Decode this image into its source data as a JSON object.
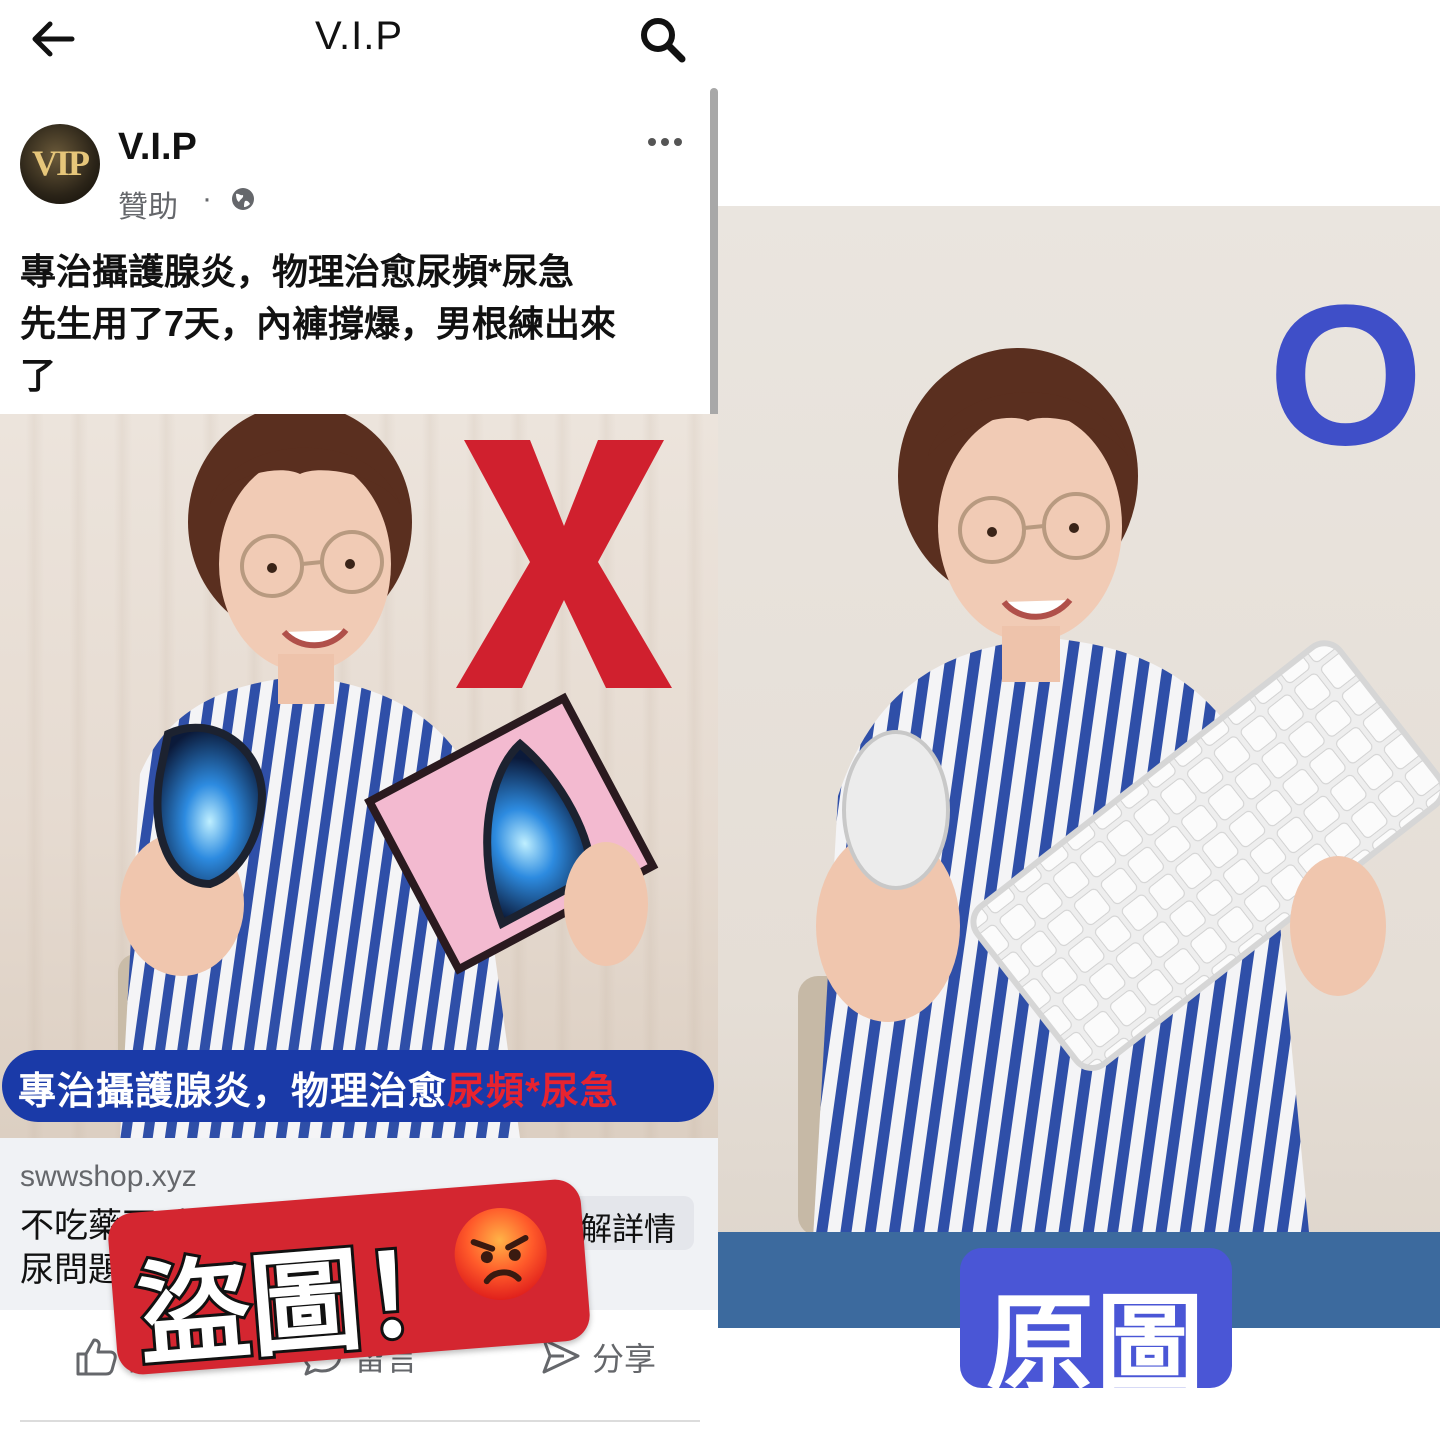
{
  "topbar": {
    "title": "V.I.P"
  },
  "post": {
    "page_name": "V.I.P",
    "avatar_mark": "VIP",
    "sponsored": "贊助",
    "dot": "·",
    "text_lines": [
      "專治攝護腺炎，物理治愈尿頻*尿急",
      "先生用了7天，內褲撐爆，男根練出來",
      "了"
    ]
  },
  "ad_image": {
    "mark": "X",
    "banner_prefix": "專治攝護腺炎，物理治愈",
    "banner_highlight": "尿頻*尿急"
  },
  "link_preview": {
    "domain": "swwshop.xyz",
    "description_lines": [
      "不吃藥不手術，物理治愈",
      "尿問題"
    ],
    "cta": "了解詳情"
  },
  "actions": {
    "like": "讚",
    "comment": "留言",
    "share": "分享"
  },
  "stolen_badge": {
    "text": "盜圖！",
    "emoji": "angry-face"
  },
  "original": {
    "mark": "O",
    "badge": "原圖"
  },
  "colors": {
    "x_red": "#d0202e",
    "o_blue": "#3f4fc8",
    "banner_blue": "#1a3aa8",
    "badge_red": "#d42630",
    "badge_blue": "#4a56d6"
  }
}
